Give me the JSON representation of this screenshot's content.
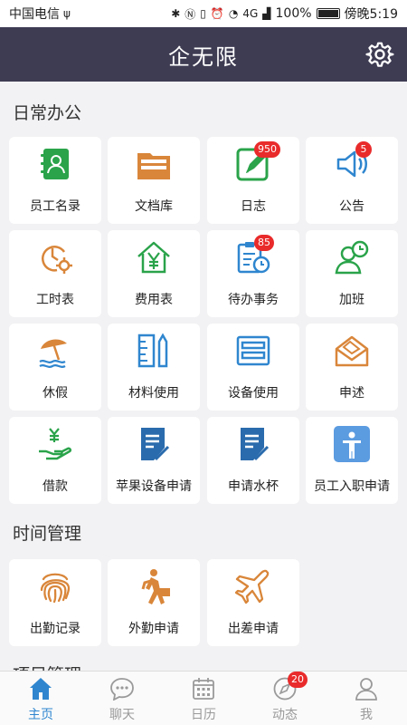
{
  "status_bar": {
    "carrier": "中国电信",
    "usb_glyph": "ψ",
    "network": "4G",
    "battery": "100%",
    "time": "傍晚5:19"
  },
  "header": {
    "title": "企无限"
  },
  "sections": [
    {
      "title": "日常办公"
    },
    {
      "title": "时间管理"
    },
    {
      "title": "项目管理"
    }
  ],
  "tiles": {
    "staff_directory": {
      "label": "员工名录"
    },
    "document_library": {
      "label": "文档库"
    },
    "log": {
      "label": "日志",
      "badge": "950"
    },
    "announcement": {
      "label": "公告",
      "badge": "5"
    },
    "timesheet": {
      "label": "工时表"
    },
    "expense": {
      "label": "费用表"
    },
    "todo": {
      "label": "待办事务",
      "badge": "85"
    },
    "overtime": {
      "label": "加班"
    },
    "leave": {
      "label": "休假"
    },
    "material": {
      "label": "材料使用"
    },
    "equipment": {
      "label": "设备使用"
    },
    "appeal": {
      "label": "申述"
    },
    "loan": {
      "label": "借款"
    },
    "apple_device": {
      "label": "苹果设备申请"
    },
    "water_cup": {
      "label": "申请水杯"
    },
    "onboarding": {
      "label": "员工入职申请"
    },
    "attendance": {
      "label": "出勤记录"
    },
    "field_work": {
      "label": "外勤申请"
    },
    "business_trip": {
      "label": "出差申请"
    }
  },
  "tabbar": {
    "home": {
      "label": "主页"
    },
    "chat": {
      "label": "聊天"
    },
    "calendar": {
      "label": "日历"
    },
    "activity": {
      "label": "动态",
      "badge": "20"
    },
    "me": {
      "label": "我"
    }
  },
  "colors": {
    "header_bg": "#3e3c53",
    "green": "#2aa34a",
    "orange": "#d9863a",
    "blue": "#2f86cf",
    "badge": "#e92b2b"
  }
}
